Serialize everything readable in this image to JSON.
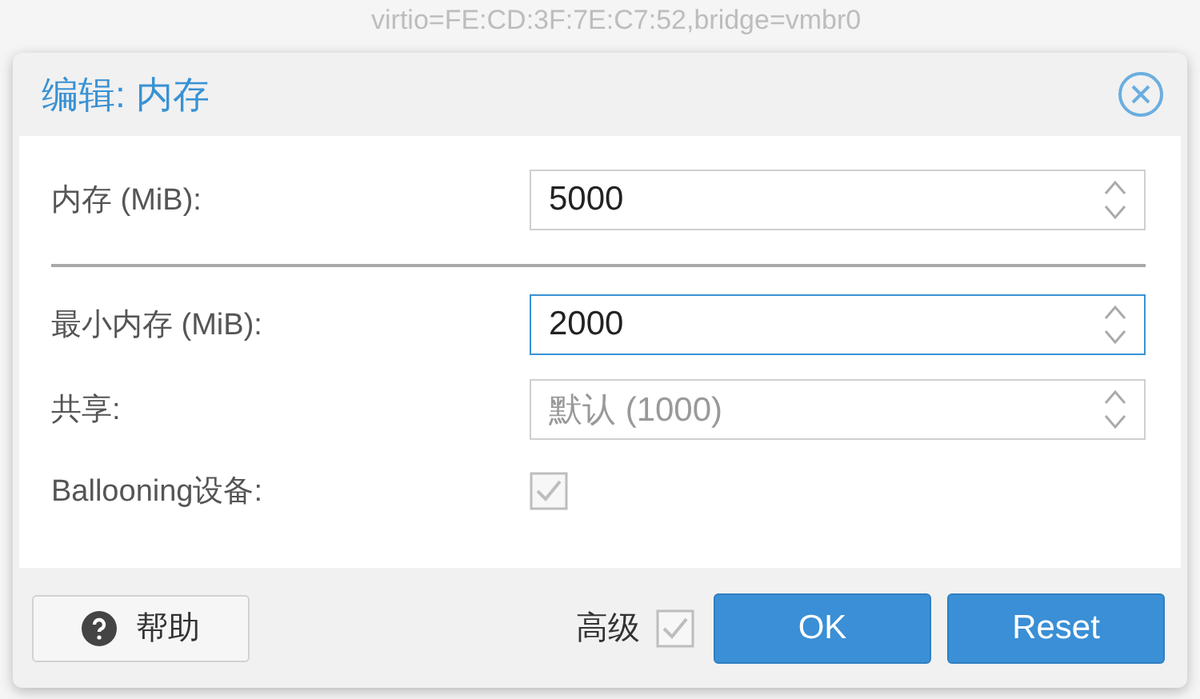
{
  "background": {
    "text": "virtio=FE:CD:3F:7E:C7:52,bridge=vmbr0"
  },
  "dialog": {
    "title": "编辑: 内存",
    "fields": [
      {
        "kind": "spinner",
        "label": "内存 (MiB):",
        "value": "5000",
        "focused": false
      },
      {
        "kind": "separator"
      },
      {
        "kind": "spinner",
        "label": "最小内存 (MiB):",
        "value": "2000",
        "focused": true
      },
      {
        "kind": "spinner",
        "label": "共享:",
        "placeholder": "默认 (1000)",
        "focused": false
      },
      {
        "kind": "checkbox",
        "label": "Ballooning设备:",
        "checked": true,
        "disabled": true
      }
    ],
    "footer": {
      "help": "帮助",
      "advanced": {
        "label": "高级",
        "checked": true
      },
      "buttons": [
        "OK",
        "Reset"
      ]
    }
  }
}
